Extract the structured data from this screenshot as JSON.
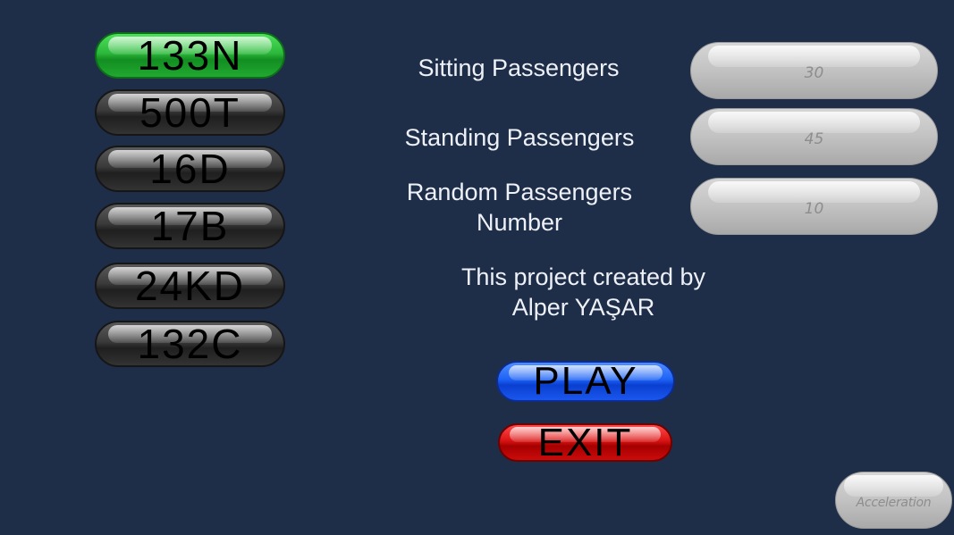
{
  "routes": [
    {
      "label": "133N",
      "active": true
    },
    {
      "label": "500T",
      "active": false
    },
    {
      "label": "16D",
      "active": false
    },
    {
      "label": "17B",
      "active": false
    },
    {
      "label": "24KD",
      "active": false
    },
    {
      "label": "132C",
      "active": false
    }
  ],
  "settings": {
    "sitting_label": "Sitting Passengers",
    "sitting_placeholder": "30",
    "standing_label": "Standing Passengers",
    "standing_placeholder": "45",
    "random_label_line1": "Random Passengers",
    "random_label_line2": "Number",
    "random_placeholder": "10"
  },
  "credits": {
    "line1": "This project created by",
    "line2": "Alper YAŞAR"
  },
  "actions": {
    "play_label": "PLAY",
    "exit_label": "EXIT"
  },
  "acceleration": {
    "placeholder": "Acceleration"
  },
  "colors": {
    "background": "#1e2d48",
    "route_active": "#2cb83b",
    "route_inactive": "#3a3a3a",
    "play": "#1d62f5",
    "exit": "#d91313"
  }
}
